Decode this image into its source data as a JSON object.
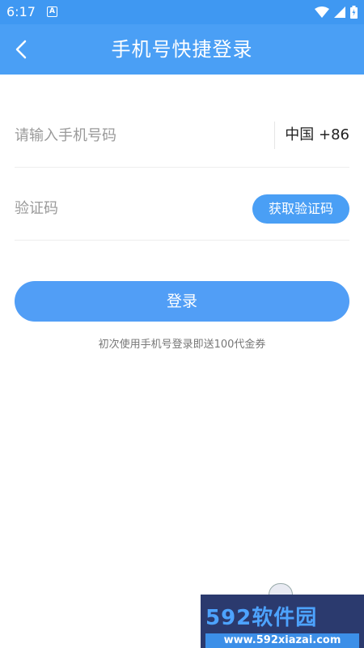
{
  "status_bar": {
    "time": "6:17",
    "notification_icon": "a-box-icon",
    "icons": [
      "wifi-icon",
      "signal-icon",
      "battery-charging-icon"
    ],
    "background": "#3f98f2"
  },
  "header": {
    "title": "手机号快捷登录",
    "back_icon": "chevron-left-icon",
    "background": "#4a9ff5"
  },
  "form": {
    "phone_placeholder": "请输入手机号码",
    "country_code": "中国 +86",
    "code_placeholder": "验证码",
    "get_code_label": "获取验证码"
  },
  "login_button": {
    "label": "登录",
    "color": "#519ef6"
  },
  "promo_text": "初次使用手机号登录即送100代金券",
  "watermark": {
    "brand": "592软件园",
    "url": "www.592xiazai.com"
  }
}
